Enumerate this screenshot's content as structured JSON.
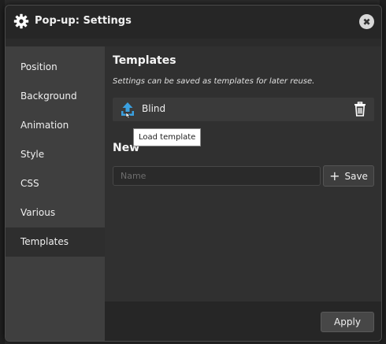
{
  "dialog": {
    "title": "Pop-up: Settings",
    "close_icon": "close-icon",
    "title_icon": "gear-icon"
  },
  "sidebar": {
    "items": [
      {
        "label": "Position",
        "active": false
      },
      {
        "label": "Background",
        "active": false
      },
      {
        "label": "Animation",
        "active": false
      },
      {
        "label": "Style",
        "active": false
      },
      {
        "label": "CSS",
        "active": false
      },
      {
        "label": "Various",
        "active": false
      },
      {
        "label": "Templates",
        "active": true
      }
    ]
  },
  "templates": {
    "heading": "Templates",
    "description": "Settings can be saved as templates for later reuse.",
    "items": [
      {
        "name": "Blind",
        "load_icon": "upload-icon",
        "delete_icon": "trash-icon"
      }
    ],
    "tooltip": "Load template"
  },
  "new_template": {
    "heading": "New",
    "name_placeholder": "Name",
    "name_value": "",
    "save_label": "Save"
  },
  "footer": {
    "apply_label": "Apply"
  },
  "colors": {
    "accent_blue": "#3aa0e0",
    "background": "#2b2b2b",
    "sidebar": "#3f3f3f"
  }
}
